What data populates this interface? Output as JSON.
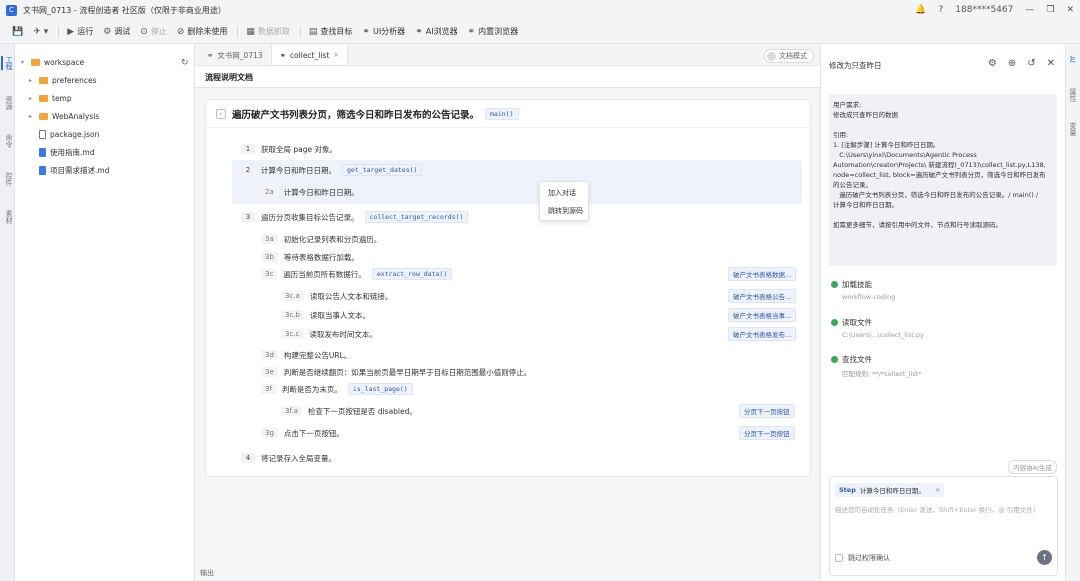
{
  "window": {
    "logo_letter": "C",
    "title": "文书网_0713 - 流程创造者 社区版（仅限于非商业用途）",
    "user": "188****5467",
    "controls": [
      "🔔",
      "?",
      "—",
      "❐",
      "✕"
    ]
  },
  "toolbar": {
    "items": [
      {
        "icon": "💾",
        "label": ""
      },
      {
        "icon": "✈",
        "label": ""
      },
      {
        "icon": "▶",
        "label": "运行"
      },
      {
        "icon": "⚙",
        "label": "调试"
      },
      {
        "icon": "⊙",
        "label": "停止"
      },
      {
        "icon": "⊘",
        "label": "删除未使用"
      },
      {
        "icon": "▦",
        "label": "数据抓取"
      },
      {
        "icon": "▤",
        "label": "查找目标"
      },
      {
        "icon": "⚭",
        "label": "UI分析器"
      },
      {
        "icon": "⚭",
        "label": "AI浏览器"
      },
      {
        "icon": "⚭",
        "label": "内置浏览器"
      }
    ]
  },
  "leftbar": {
    "tabs": [
      "工程",
      "资源",
      "命令",
      "控件",
      "素材"
    ]
  },
  "explorer": {
    "root": "workspace",
    "items": [
      "preferences",
      "temp",
      "WebAnalysis",
      "package.json",
      "使用指南.md",
      "项目需求描述.md"
    ]
  },
  "editor": {
    "tabs": [
      {
        "label": "文书网_0713"
      },
      {
        "label": "collect_list",
        "close": "×"
      }
    ],
    "doc_mode": "文档模式",
    "header": "流程说明文档",
    "card": {
      "collapse": "-",
      "title": "遍历破产文书列表分页，筛选今日和昨日发布的公告记录。",
      "code": "main()"
    },
    "steps": [
      {
        "num": "1",
        "text": "获取全局 page 对象。",
        "code": ""
      },
      {
        "num": "2",
        "text": "计算今日和昨日日期。",
        "code": "get_target_dates()"
      },
      {
        "num": "2a",
        "text": "计算今日和昨日日期。",
        "code": ""
      },
      {
        "num": "3",
        "text": "遍历分页收集目标公告记录。",
        "code": "collect_target_records()"
      },
      {
        "num": "3a",
        "text": "初始化记录列表和分页遍历。",
        "code": ""
      },
      {
        "num": "3b",
        "text": "等待表格数据行加载。",
        "code": ""
      },
      {
        "num": "3c",
        "text": "遍历当前页所有数据行。",
        "code": "extract_row_data()"
      },
      {
        "num": "3c.a",
        "text": "读取公告人文本和链接。",
        "code": ""
      },
      {
        "num": "3c.b",
        "text": "读取当事人文本。",
        "code": ""
      },
      {
        "num": "3c.c",
        "text": "读取发布时间文本。",
        "code": ""
      },
      {
        "num": "3d",
        "text": "构建完整公告URL。",
        "code": ""
      },
      {
        "num": "3e",
        "text": "判断是否继续翻页：如果当前页最早日期早于目标日期范围最小值则停止。",
        "code": ""
      },
      {
        "num": "3f",
        "text": "判断是否为末页。",
        "code": "is_last_page()"
      },
      {
        "num": "3f.a",
        "text": "检查下一页按钮是否 disabled。",
        "code": ""
      },
      {
        "num": "3g",
        "text": "点击下一页按钮。",
        "code": ""
      },
      {
        "num": "4",
        "text": "将记录存入全局变量。",
        "code": ""
      }
    ],
    "refs": [
      "破产文书表格数据...",
      "破产文书表格公告...",
      "破产文书表格当事...",
      "破产文书表格发布...",
      "分页下一页按钮",
      "分页下一页按钮"
    ],
    "context_menu": [
      "加入对话",
      "跳转到源码"
    ],
    "output_label": "输出"
  },
  "right_panel": {
    "title": "修改为只查昨日",
    "icons": [
      "⚙",
      "⊕",
      "↺",
      "✕"
    ],
    "message": [
      "用户需求:",
      "修改成只查昨日的数据",
      "",
      "引用:",
      "1. [注解步骤] 计算今日和昨日日期。",
      "   C:\\Users\\yinxi\\Documents\\Agentic Process",
      "Automation\\creator\\Projects\\ 新建流程(_0713)\\collect_list.py,L138,",
      "node=collect_list, block=遍历破产文书列表分页，筛选今日和昨日发布",
      "的公告记录。",
      "   遍历破产文书列表分页，筛选今日和昨日发布的公告记录。/ main() /",
      "计算今日和昨日日期。",
      "",
      "如需更多细节，请按引用中的文件、节点和行号读取源码。"
    ],
    "tools": [
      {
        "title": "加载技能",
        "detail": "workflow-coding"
      },
      {
        "title": "读取文件",
        "detail": "C:\\Users\\...\\collect_list.py"
      },
      {
        "title": "查找文件",
        "detail": "匹配规则: **/*collect_list*"
      }
    ],
    "ai_tag": "内容由AI生成",
    "input": {
      "chip_step": "Step",
      "chip_text": "计算今日和昨日日期。",
      "chip_close": "×",
      "placeholder": "描述您的自动化任务（Enter 发送，Shift+Enter 换行，@ 引用文件）",
      "skip_label": "跳过权限确认",
      "send": "↑"
    }
  },
  "farbar": {
    "tabs": [
      "AI",
      "属性",
      "变量"
    ]
  }
}
